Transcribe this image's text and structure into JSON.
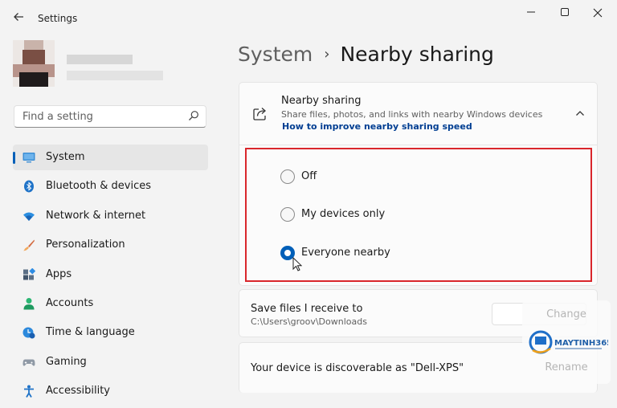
{
  "window": {
    "title": "Settings",
    "back_icon": "arrow-left-icon",
    "minimize_icon": "minimize-icon",
    "maximize_icon": "maximize-icon",
    "close_icon": "close-icon"
  },
  "search": {
    "placeholder": "Find a setting",
    "icon": "search-icon"
  },
  "sidebar": {
    "items": [
      {
        "label": "System",
        "icon": "monitor-icon",
        "active": true
      },
      {
        "label": "Bluetooth & devices",
        "icon": "bluetooth-icon",
        "active": false
      },
      {
        "label": "Network & internet",
        "icon": "wifi-icon",
        "active": false
      },
      {
        "label": "Personalization",
        "icon": "brush-icon",
        "active": false
      },
      {
        "label": "Apps",
        "icon": "apps-icon",
        "active": false
      },
      {
        "label": "Accounts",
        "icon": "person-icon",
        "active": false
      },
      {
        "label": "Time & language",
        "icon": "clock-globe-icon",
        "active": false
      },
      {
        "label": "Gaming",
        "icon": "gamepad-icon",
        "active": false
      },
      {
        "label": "Accessibility",
        "icon": "accessibility-icon",
        "active": false
      }
    ]
  },
  "header": {
    "parent": "System",
    "separator": "›",
    "current": "Nearby sharing"
  },
  "nearby": {
    "title": "Nearby sharing",
    "description": "Share files, photos, and links with nearby Windows devices",
    "link": "How to improve nearby sharing speed",
    "options": [
      {
        "label": "Off",
        "selected": false
      },
      {
        "label": "My devices only",
        "selected": false
      },
      {
        "label": "Everyone nearby",
        "selected": true
      }
    ]
  },
  "save_files": {
    "title": "Save files I receive to",
    "path": "C:\\Users\\groov\\Downloads",
    "button": "Change"
  },
  "device": {
    "text": "Your device is discoverable as \"Dell-XPS\"",
    "button": "Rename"
  },
  "watermark": {
    "brand": "MAYTINH365"
  },
  "colors": {
    "accent": "#005fb8",
    "highlight_border": "#d9262b",
    "link": "#003e92"
  }
}
